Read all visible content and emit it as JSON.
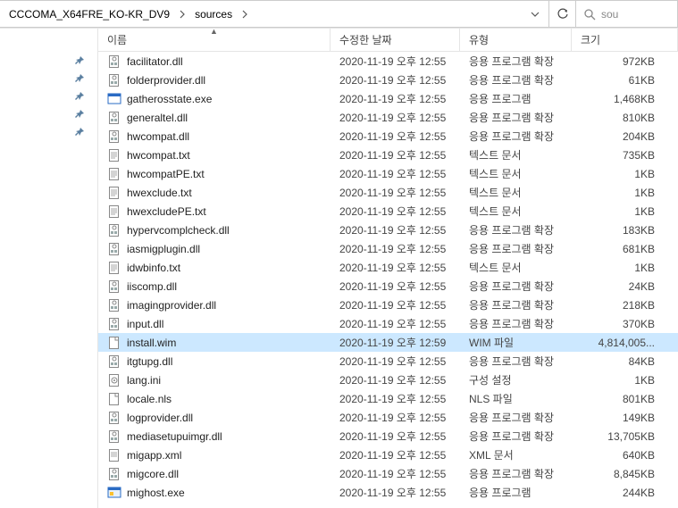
{
  "breadcrumb": {
    "parent": "CCCOMA_X64FRE_KO-KR_DV9",
    "current": "sources"
  },
  "search_placeholder": "sou",
  "columns": {
    "name": "이름",
    "date": "수정한 날짜",
    "type": "유형",
    "size": "크기"
  },
  "selected_index": 15,
  "pins_count": 5,
  "files": [
    {
      "icon": "dll",
      "name": "facilitator.dll",
      "date": "2020-11-19 오후 12:55",
      "type": "응용 프로그램 확장",
      "size": "972KB"
    },
    {
      "icon": "dll",
      "name": "folderprovider.dll",
      "date": "2020-11-19 오후 12:55",
      "type": "응용 프로그램 확장",
      "size": "61KB"
    },
    {
      "icon": "exe",
      "name": "gatherosstate.exe",
      "date": "2020-11-19 오후 12:55",
      "type": "응용 프로그램",
      "size": "1,468KB"
    },
    {
      "icon": "dll",
      "name": "generaltel.dll",
      "date": "2020-11-19 오후 12:55",
      "type": "응용 프로그램 확장",
      "size": "810KB"
    },
    {
      "icon": "dll",
      "name": "hwcompat.dll",
      "date": "2020-11-19 오후 12:55",
      "type": "응용 프로그램 확장",
      "size": "204KB"
    },
    {
      "icon": "txt",
      "name": "hwcompat.txt",
      "date": "2020-11-19 오후 12:55",
      "type": "텍스트 문서",
      "size": "735KB"
    },
    {
      "icon": "txt",
      "name": "hwcompatPE.txt",
      "date": "2020-11-19 오후 12:55",
      "type": "텍스트 문서",
      "size": "1KB"
    },
    {
      "icon": "txt",
      "name": "hwexclude.txt",
      "date": "2020-11-19 오후 12:55",
      "type": "텍스트 문서",
      "size": "1KB"
    },
    {
      "icon": "txt",
      "name": "hwexcludePE.txt",
      "date": "2020-11-19 오후 12:55",
      "type": "텍스트 문서",
      "size": "1KB"
    },
    {
      "icon": "dll",
      "name": "hypervcomplcheck.dll",
      "date": "2020-11-19 오후 12:55",
      "type": "응용 프로그램 확장",
      "size": "183KB"
    },
    {
      "icon": "dll",
      "name": "iasmigplugin.dll",
      "date": "2020-11-19 오후 12:55",
      "type": "응용 프로그램 확장",
      "size": "681KB"
    },
    {
      "icon": "txt",
      "name": "idwbinfo.txt",
      "date": "2020-11-19 오후 12:55",
      "type": "텍스트 문서",
      "size": "1KB"
    },
    {
      "icon": "dll",
      "name": "iiscomp.dll",
      "date": "2020-11-19 오후 12:55",
      "type": "응용 프로그램 확장",
      "size": "24KB"
    },
    {
      "icon": "dll",
      "name": "imagingprovider.dll",
      "date": "2020-11-19 오후 12:55",
      "type": "응용 프로그램 확장",
      "size": "218KB"
    },
    {
      "icon": "dll",
      "name": "input.dll",
      "date": "2020-11-19 오후 12:55",
      "type": "응용 프로그램 확장",
      "size": "370KB"
    },
    {
      "icon": "file",
      "name": "install.wim",
      "date": "2020-11-19 오후 12:59",
      "type": "WIM 파일",
      "size": "4,814,005..."
    },
    {
      "icon": "dll",
      "name": "itgtupg.dll",
      "date": "2020-11-19 오후 12:55",
      "type": "응용 프로그램 확장",
      "size": "84KB"
    },
    {
      "icon": "ini",
      "name": "lang.ini",
      "date": "2020-11-19 오후 12:55",
      "type": "구성 설정",
      "size": "1KB"
    },
    {
      "icon": "file",
      "name": "locale.nls",
      "date": "2020-11-19 오후 12:55",
      "type": "NLS 파일",
      "size": "801KB"
    },
    {
      "icon": "dll",
      "name": "logprovider.dll",
      "date": "2020-11-19 오후 12:55",
      "type": "응용 프로그램 확장",
      "size": "149KB"
    },
    {
      "icon": "dll",
      "name": "mediasetupuimgr.dll",
      "date": "2020-11-19 오후 12:55",
      "type": "응용 프로그램 확장",
      "size": "13,705KB"
    },
    {
      "icon": "xml",
      "name": "migapp.xml",
      "date": "2020-11-19 오후 12:55",
      "type": "XML 문서",
      "size": "640KB"
    },
    {
      "icon": "dll",
      "name": "migcore.dll",
      "date": "2020-11-19 오후 12:55",
      "type": "응용 프로그램 확장",
      "size": "8,845KB"
    },
    {
      "icon": "exe2",
      "name": "mighost.exe",
      "date": "2020-11-19 오후 12:55",
      "type": "응용 프로그램",
      "size": "244KB"
    }
  ]
}
